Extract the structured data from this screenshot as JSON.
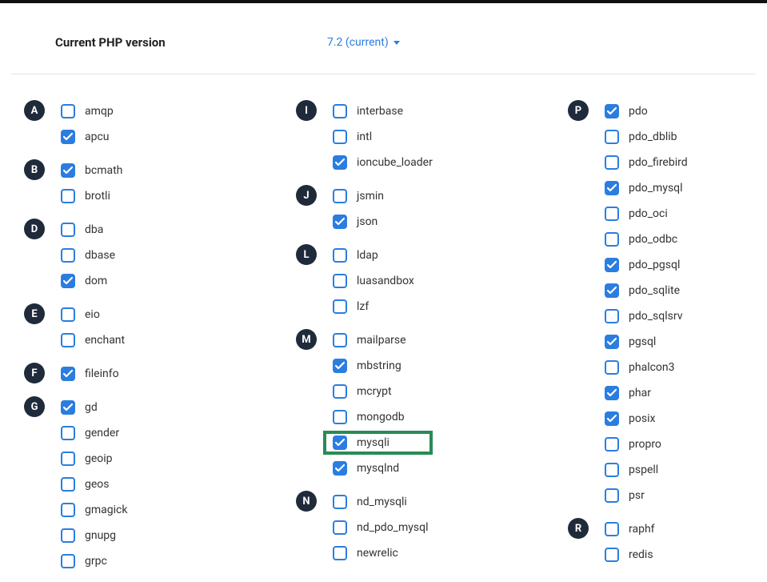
{
  "header": {
    "label": "Current PHP version",
    "version": "7.2 (current)"
  },
  "columns": [
    {
      "groups": [
        {
          "letter": "A",
          "items": [
            {
              "label": "amqp",
              "checked": false
            },
            {
              "label": "apcu",
              "checked": true
            }
          ]
        },
        {
          "letter": "B",
          "items": [
            {
              "label": "bcmath",
              "checked": true
            },
            {
              "label": "brotli",
              "checked": false
            }
          ]
        },
        {
          "letter": "D",
          "items": [
            {
              "label": "dba",
              "checked": false
            },
            {
              "label": "dbase",
              "checked": false
            },
            {
              "label": "dom",
              "checked": true
            }
          ]
        },
        {
          "letter": "E",
          "items": [
            {
              "label": "eio",
              "checked": false
            },
            {
              "label": "enchant",
              "checked": false
            }
          ]
        },
        {
          "letter": "F",
          "items": [
            {
              "label": "fileinfo",
              "checked": true
            }
          ]
        },
        {
          "letter": "G",
          "items": [
            {
              "label": "gd",
              "checked": true
            },
            {
              "label": "gender",
              "checked": false
            },
            {
              "label": "geoip",
              "checked": false
            },
            {
              "label": "geos",
              "checked": false
            },
            {
              "label": "gmagick",
              "checked": false
            },
            {
              "label": "gnupg",
              "checked": false
            },
            {
              "label": "grpc",
              "checked": false
            }
          ]
        }
      ]
    },
    {
      "groups": [
        {
          "letter": "I",
          "items": [
            {
              "label": "interbase",
              "checked": false
            },
            {
              "label": "intl",
              "checked": false
            },
            {
              "label": "ioncube_loader",
              "checked": true
            }
          ]
        },
        {
          "letter": "J",
          "items": [
            {
              "label": "jsmin",
              "checked": false
            },
            {
              "label": "json",
              "checked": true
            }
          ]
        },
        {
          "letter": "L",
          "items": [
            {
              "label": "ldap",
              "checked": false
            },
            {
              "label": "luasandbox",
              "checked": false
            },
            {
              "label": "lzf",
              "checked": false
            }
          ]
        },
        {
          "letter": "M",
          "items": [
            {
              "label": "mailparse",
              "checked": false
            },
            {
              "label": "mbstring",
              "checked": true
            },
            {
              "label": "mcrypt",
              "checked": false
            },
            {
              "label": "mongodb",
              "checked": false
            },
            {
              "label": "mysqli",
              "checked": true,
              "highlighted": true
            },
            {
              "label": "mysqlnd",
              "checked": true
            }
          ]
        },
        {
          "letter": "N",
          "items": [
            {
              "label": "nd_mysqli",
              "checked": false
            },
            {
              "label": "nd_pdo_mysql",
              "checked": false
            },
            {
              "label": "newrelic",
              "checked": false
            }
          ]
        }
      ]
    },
    {
      "groups": [
        {
          "letter": "P",
          "items": [
            {
              "label": "pdo",
              "checked": true
            },
            {
              "label": "pdo_dblib",
              "checked": false
            },
            {
              "label": "pdo_firebird",
              "checked": false
            },
            {
              "label": "pdo_mysql",
              "checked": true
            },
            {
              "label": "pdo_oci",
              "checked": false
            },
            {
              "label": "pdo_odbc",
              "checked": false
            },
            {
              "label": "pdo_pgsql",
              "checked": true
            },
            {
              "label": "pdo_sqlite",
              "checked": true
            },
            {
              "label": "pdo_sqlsrv",
              "checked": false
            },
            {
              "label": "pgsql",
              "checked": true
            },
            {
              "label": "phalcon3",
              "checked": false
            },
            {
              "label": "phar",
              "checked": true
            },
            {
              "label": "posix",
              "checked": true
            },
            {
              "label": "propro",
              "checked": false
            },
            {
              "label": "pspell",
              "checked": false
            },
            {
              "label": "psr",
              "checked": false
            }
          ]
        },
        {
          "letter": "R",
          "items": [
            {
              "label": "raphf",
              "checked": false
            },
            {
              "label": "redis",
              "checked": false
            }
          ]
        }
      ]
    }
  ]
}
